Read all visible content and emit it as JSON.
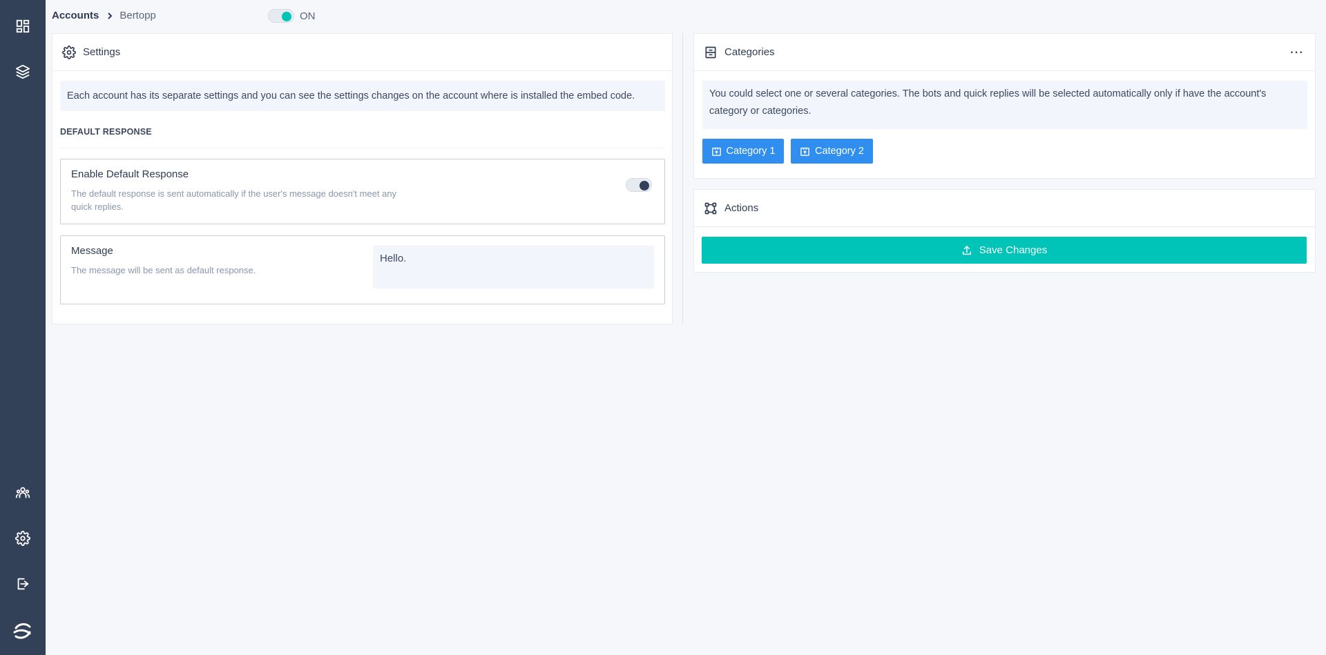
{
  "breadcrumb": {
    "root": "Accounts",
    "current": "Bertopp"
  },
  "account_toggle": {
    "label": "ON",
    "state": true
  },
  "sidebar": {
    "top_icons": [
      "dashboard-icon",
      "layers-icon"
    ],
    "bottom_icons": [
      "users-icon",
      "gear-icon",
      "logout-icon",
      "logo-icon"
    ]
  },
  "settings": {
    "title": "Settings",
    "info": "Each account has its separate settings and you can see the settings changes on the account where is installed the embed code.",
    "section_title": "DEFAULT RESPONSE",
    "enable_default": {
      "title": "Enable Default Response",
      "description": "The default response is sent automatically if the user's message doesn't meet any quick replies.",
      "state": true
    },
    "message": {
      "title": "Message",
      "description": "The message will be sent as default response.",
      "value": "Hello."
    }
  },
  "categories": {
    "title": "Categories",
    "info": "You could select one or several categories. The bots and quick replies will be selected automatically only if have the account's category or categories.",
    "items": [
      "Category 1",
      "Category 2"
    ]
  },
  "actions": {
    "title": "Actions",
    "save_label": "Save Changes"
  },
  "colors": {
    "sidebar": "#334158",
    "accent": "#00c4b8",
    "category_button": "#2f8ef0"
  }
}
